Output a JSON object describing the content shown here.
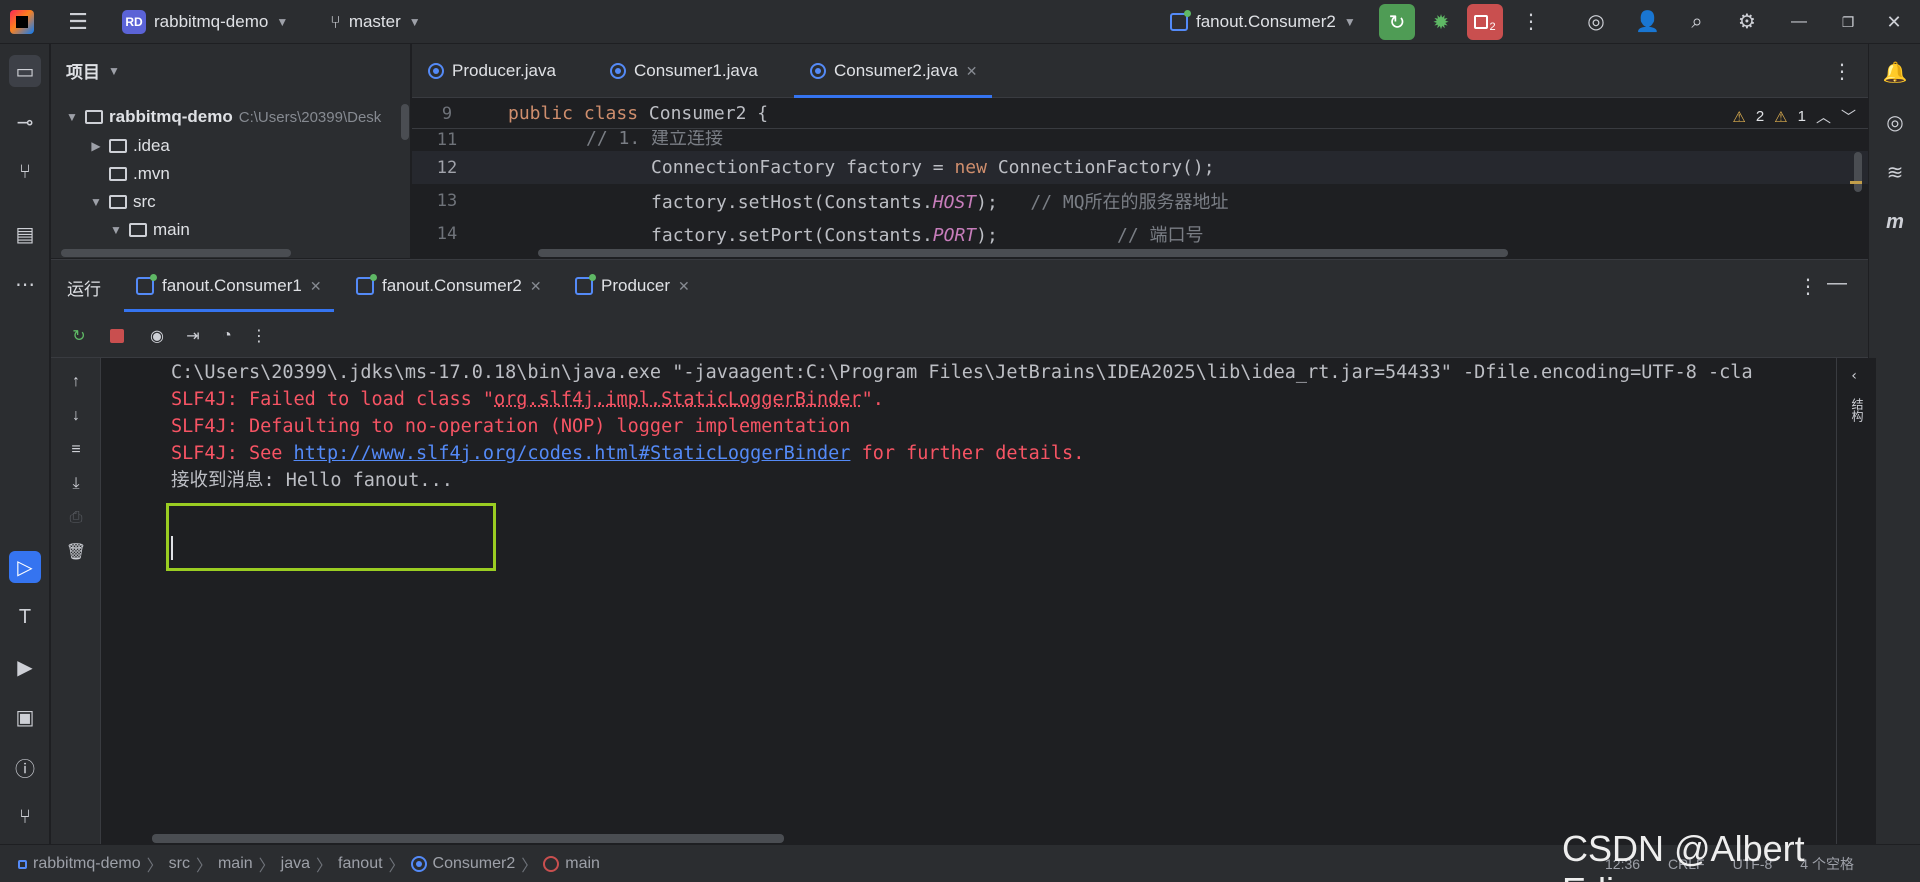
{
  "titlebar": {
    "project_badge": "RD",
    "project_name": "rabbitmq-demo",
    "branch": "master",
    "run_config": "fanout.Consumer2",
    "stop_badge": "2"
  },
  "project_panel": {
    "title": "项目",
    "root_name": "rabbitmq-demo",
    "root_path": "C:\\Users\\20399\\Desk",
    "items": [
      {
        "label": ".idea"
      },
      {
        "label": ".mvn"
      },
      {
        "label": "src"
      },
      {
        "label": "main"
      }
    ]
  },
  "editor": {
    "tabs": [
      {
        "label": "Producer.java"
      },
      {
        "label": "Consumer1.java"
      },
      {
        "label": "Consumer2.java"
      }
    ],
    "sticky_line_no": "9",
    "sticky": {
      "kw1": "public",
      "kw2": "class",
      "name": "Consumer2 {"
    },
    "inspections": {
      "warnings": "2",
      "weak_warnings": "1"
    },
    "lines": [
      {
        "no": "11",
        "code": "// 1. 建立连接"
      },
      {
        "no": "12",
        "pre": "ConnectionFactory factory = ",
        "kw": "new",
        "post": " ConnectionFactory();"
      },
      {
        "no": "13",
        "pre": "factory.setHost(Constants.",
        "field": "HOST",
        "post": ");",
        "comment": "   // MQ所在的服务器地址"
      },
      {
        "no": "14",
        "pre": "factory.setPort(Constants.",
        "field": "PORT",
        "post": ");",
        "comment": "           // 端口号"
      }
    ]
  },
  "run_panel": {
    "title": "运行",
    "tabs": [
      {
        "label": "fanout.Consumer1"
      },
      {
        "label": "fanout.Consumer2"
      },
      {
        "label": "Producer"
      }
    ],
    "console": {
      "cmd": "C:\\Users\\20399\\.jdks\\ms-17.0.18\\bin\\java.exe \"-javaagent:C:\\Program Files\\JetBrains\\IDEA2025\\lib\\idea_rt.jar=54433\" -Dfile.encoding=UTF-8 -cla",
      "err1_pre": "SLF4J: Failed to load class \"",
      "err1_cls": "org.slf4j.impl.StaticLoggerBinder",
      "err1_post": "\".",
      "err2": "SLF4J: Defaulting to no-operation (NOP) logger implementation",
      "err3_pre": "SLF4J: See ",
      "err3_link": "http://www.slf4j.org/codes.html#StaticLoggerBinder",
      "err3_post": " for further details.",
      "received": "接收到消息: Hello fanout..."
    },
    "side_label": "结构"
  },
  "statusbar": {
    "crumbs": [
      "rabbitmq-demo",
      "src",
      "main",
      "java",
      "fanout",
      "Consumer2",
      "main"
    ],
    "position": "12:36",
    "line_sep": "CRLF",
    "encoding": "UTF-8",
    "indent": "4 个空格"
  },
  "watermark": "CSDN @Albert Edison"
}
